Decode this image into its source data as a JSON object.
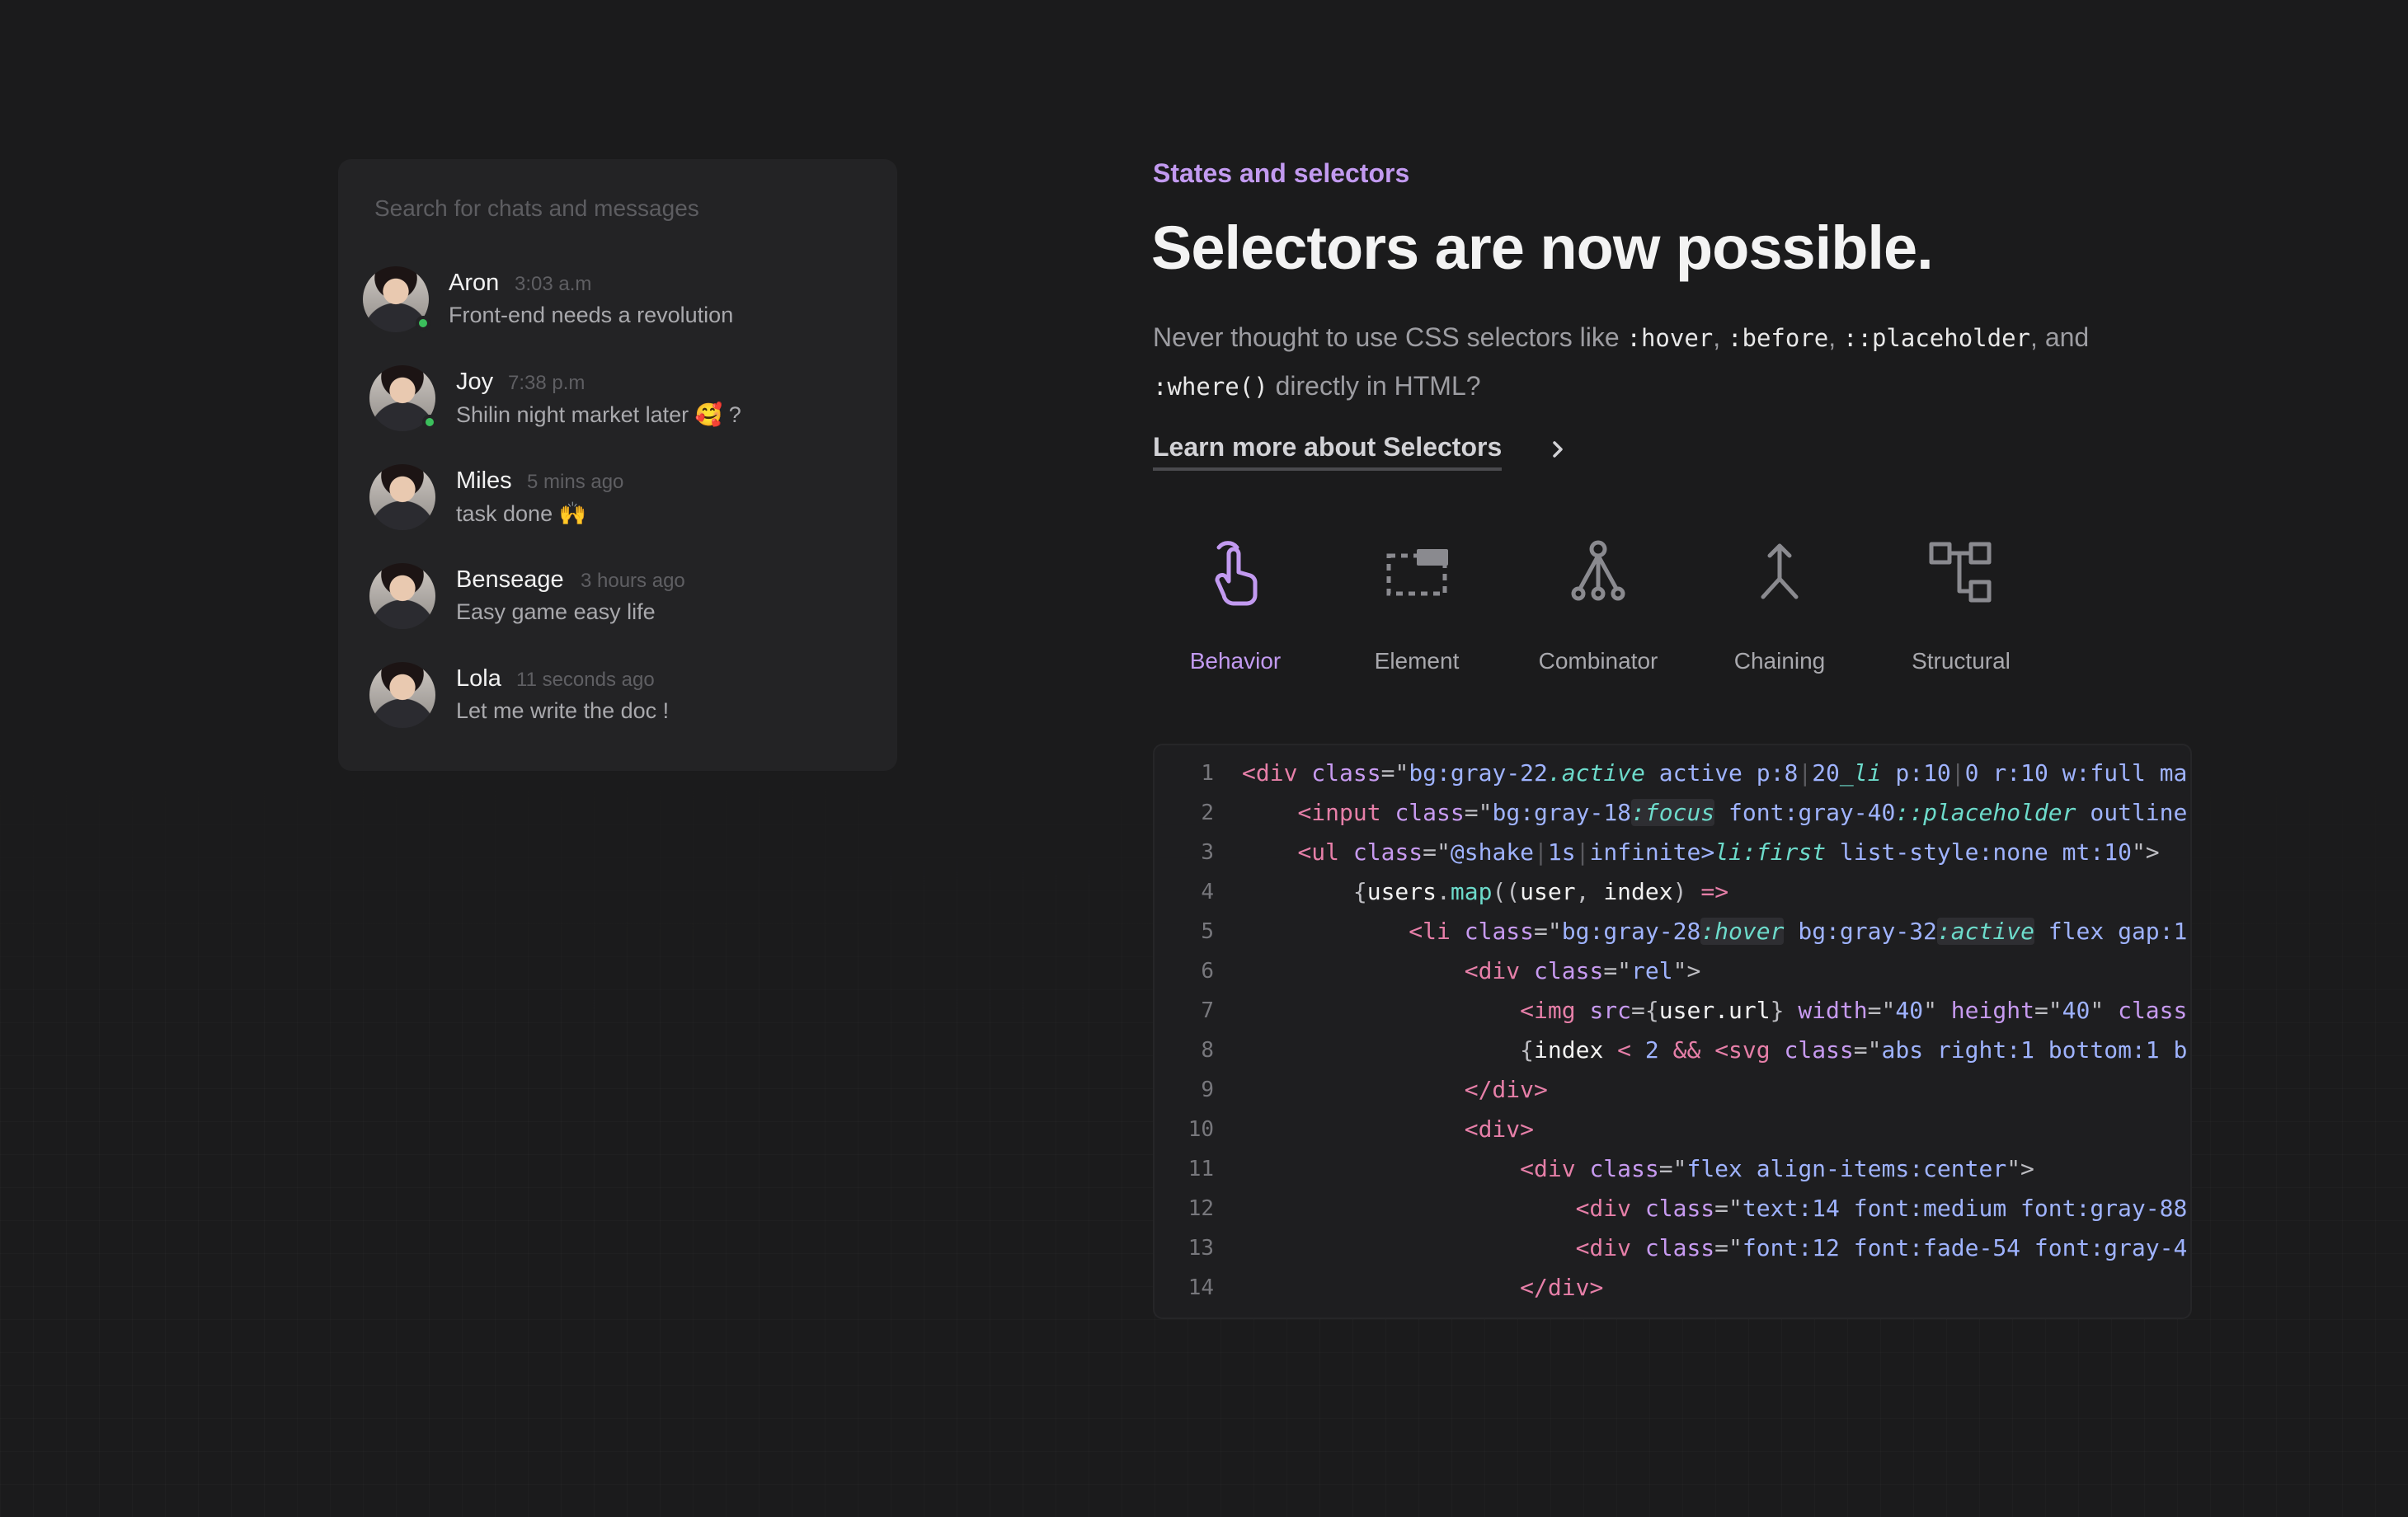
{
  "chat": {
    "search_placeholder": "Search for chats and messages",
    "items": [
      {
        "name": "Aron",
        "time": "3:03 a.m",
        "message": "Front-end needs a revolution",
        "online": true
      },
      {
        "name": "Joy",
        "time": "7:38 p.m",
        "message": "Shilin night market later 🥰 ?",
        "online": true
      },
      {
        "name": "Miles",
        "time": "5 mins ago",
        "message": "task done 🙌",
        "online": false
      },
      {
        "name": "Benseage",
        "time": "3 hours ago",
        "message": "Easy game easy life",
        "online": false
      },
      {
        "name": "Lola",
        "time": "11 seconds ago",
        "message": "Let me write the doc !",
        "online": false
      }
    ]
  },
  "hero": {
    "eyebrow": "States and selectors",
    "headline": "Selectors are now possible.",
    "desc_prefix": "Never thought to use CSS selectors like ",
    "code_hover": ":hover",
    "sep1": ", ",
    "code_before": ":before",
    "sep2": ", ",
    "code_placeholder": "::placeholder",
    "sep3": ", and ",
    "code_where": ":where()",
    "desc_suffix": " directly in HTML?",
    "link_label": "Learn more about Selectors"
  },
  "tabs": [
    {
      "label": "Behavior",
      "icon": "pointer-hand-icon",
      "active": true
    },
    {
      "label": "Element",
      "icon": "element-box-icon",
      "active": false
    },
    {
      "label": "Combinator",
      "icon": "tree-combinator-icon",
      "active": false
    },
    {
      "label": "Chaining",
      "icon": "chaining-arrow-icon",
      "active": false
    },
    {
      "label": "Structural",
      "icon": "structure-icon",
      "active": false
    }
  ],
  "colors": {
    "accent": "#c29af0",
    "background": "#1b1b1c",
    "panel": "#232325",
    "online": "#3bbf5c"
  },
  "code": {
    "line_numbers": [
      "1",
      "2",
      "3",
      "4",
      "5",
      "6",
      "7",
      "8",
      "9",
      "10",
      "11",
      "12",
      "13",
      "14"
    ],
    "lines": [
      [
        [
          "t-tag",
          "<div "
        ],
        [
          "t-attr",
          "class"
        ],
        [
          "t-pun",
          "=\""
        ],
        [
          "t-str",
          "bg:gray-22"
        ],
        [
          "t-sel",
          ".active"
        ],
        [
          "t-str",
          " active p:8"
        ],
        [
          "t-pipe",
          "|"
        ],
        [
          "t-str",
          "20"
        ],
        [
          "t-sel",
          "_li"
        ],
        [
          "t-str",
          " p:10"
        ],
        [
          "t-pipe",
          "|"
        ],
        [
          "t-str",
          "0 r:10 w:full ma"
        ]
      ],
      [
        [
          "t-pun",
          "    "
        ],
        [
          "t-tag",
          "<input "
        ],
        [
          "t-attr",
          "class"
        ],
        [
          "t-pun",
          "=\""
        ],
        [
          "t-str",
          "bg:gray-18"
        ],
        [
          "t-selb",
          ":focus"
        ],
        [
          "t-str",
          " font:gray-40"
        ],
        [
          "t-sel",
          "::placeholder"
        ],
        [
          "t-str",
          " outline"
        ]
      ],
      [
        [
          "t-pun",
          "    "
        ],
        [
          "t-tag",
          "<ul "
        ],
        [
          "t-attr",
          "class"
        ],
        [
          "t-pun",
          "=\""
        ],
        [
          "t-str",
          "@shake"
        ],
        [
          "t-pipe",
          "|"
        ],
        [
          "t-str",
          "1s"
        ],
        [
          "t-pipe",
          "|"
        ],
        [
          "t-str",
          "infinite>"
        ],
        [
          "t-sel",
          "li:first"
        ],
        [
          "t-str",
          " list-style:none mt:10"
        ],
        [
          "t-pun",
          "\">"
        ]
      ],
      [
        [
          "t-pun",
          "        {"
        ],
        [
          "t-var",
          "users"
        ],
        [
          "t-pun",
          "."
        ],
        [
          "t-func",
          "map"
        ],
        [
          "t-pun",
          "(("
        ],
        [
          "t-var",
          "user"
        ],
        [
          "t-pun",
          ", "
        ],
        [
          "t-var",
          "index"
        ],
        [
          "t-pun",
          ") "
        ],
        [
          "t-tag",
          "=>"
        ]
      ],
      [
        [
          "t-pun",
          "            "
        ],
        [
          "t-tag",
          "<li "
        ],
        [
          "t-attr",
          "class"
        ],
        [
          "t-pun",
          "=\""
        ],
        [
          "t-str",
          "bg:gray-28"
        ],
        [
          "t-selb",
          ":hover"
        ],
        [
          "t-str",
          " bg:gray-32"
        ],
        [
          "t-selb",
          ":active"
        ],
        [
          "t-str",
          " flex gap:1"
        ]
      ],
      [
        [
          "t-pun",
          "                "
        ],
        [
          "t-tag",
          "<div "
        ],
        [
          "t-attr",
          "class"
        ],
        [
          "t-pun",
          "=\""
        ],
        [
          "t-str",
          "rel"
        ],
        [
          "t-pun",
          "\">"
        ]
      ],
      [
        [
          "t-pun",
          "                    "
        ],
        [
          "t-tag",
          "<img "
        ],
        [
          "t-attr",
          "src"
        ],
        [
          "t-pun",
          "={"
        ],
        [
          "t-var",
          "user.url"
        ],
        [
          "t-pun",
          "} "
        ],
        [
          "t-attr",
          "width"
        ],
        [
          "t-pun",
          "=\""
        ],
        [
          "t-str",
          "40"
        ],
        [
          "t-pun",
          "\" "
        ],
        [
          "t-attr",
          "height"
        ],
        [
          "t-pun",
          "=\""
        ],
        [
          "t-str",
          "40"
        ],
        [
          "t-pun",
          "\" "
        ],
        [
          "t-attr",
          "class"
        ]
      ],
      [
        [
          "t-pun",
          "                    {"
        ],
        [
          "t-var",
          "index"
        ],
        [
          "t-tag",
          " < "
        ],
        [
          "t-str",
          "2"
        ],
        [
          "t-tag",
          " && "
        ],
        [
          "t-tag",
          "<svg "
        ],
        [
          "t-attr",
          "class"
        ],
        [
          "t-pun",
          "=\""
        ],
        [
          "t-str",
          "abs right:1 bottom:1 b"
        ]
      ],
      [
        [
          "t-pun",
          "                "
        ],
        [
          "t-tag",
          "</div>"
        ]
      ],
      [
        [
          "t-pun",
          "                "
        ],
        [
          "t-tag",
          "<div>"
        ]
      ],
      [
        [
          "t-pun",
          "                    "
        ],
        [
          "t-tag",
          "<div "
        ],
        [
          "t-attr",
          "class"
        ],
        [
          "t-pun",
          "=\""
        ],
        [
          "t-str",
          "flex align-items:center"
        ],
        [
          "t-pun",
          "\">"
        ]
      ],
      [
        [
          "t-pun",
          "                        "
        ],
        [
          "t-tag",
          "<div "
        ],
        [
          "t-attr",
          "class"
        ],
        [
          "t-pun",
          "=\""
        ],
        [
          "t-str",
          "text:14 font:medium font:gray-88"
        ]
      ],
      [
        [
          "t-pun",
          "                        "
        ],
        [
          "t-tag",
          "<div "
        ],
        [
          "t-attr",
          "class"
        ],
        [
          "t-pun",
          "=\""
        ],
        [
          "t-str",
          "font:12 font:fade-54 font:gray-4"
        ]
      ],
      [
        [
          "t-pun",
          "                    "
        ],
        [
          "t-tag",
          "</div>"
        ]
      ]
    ]
  }
}
